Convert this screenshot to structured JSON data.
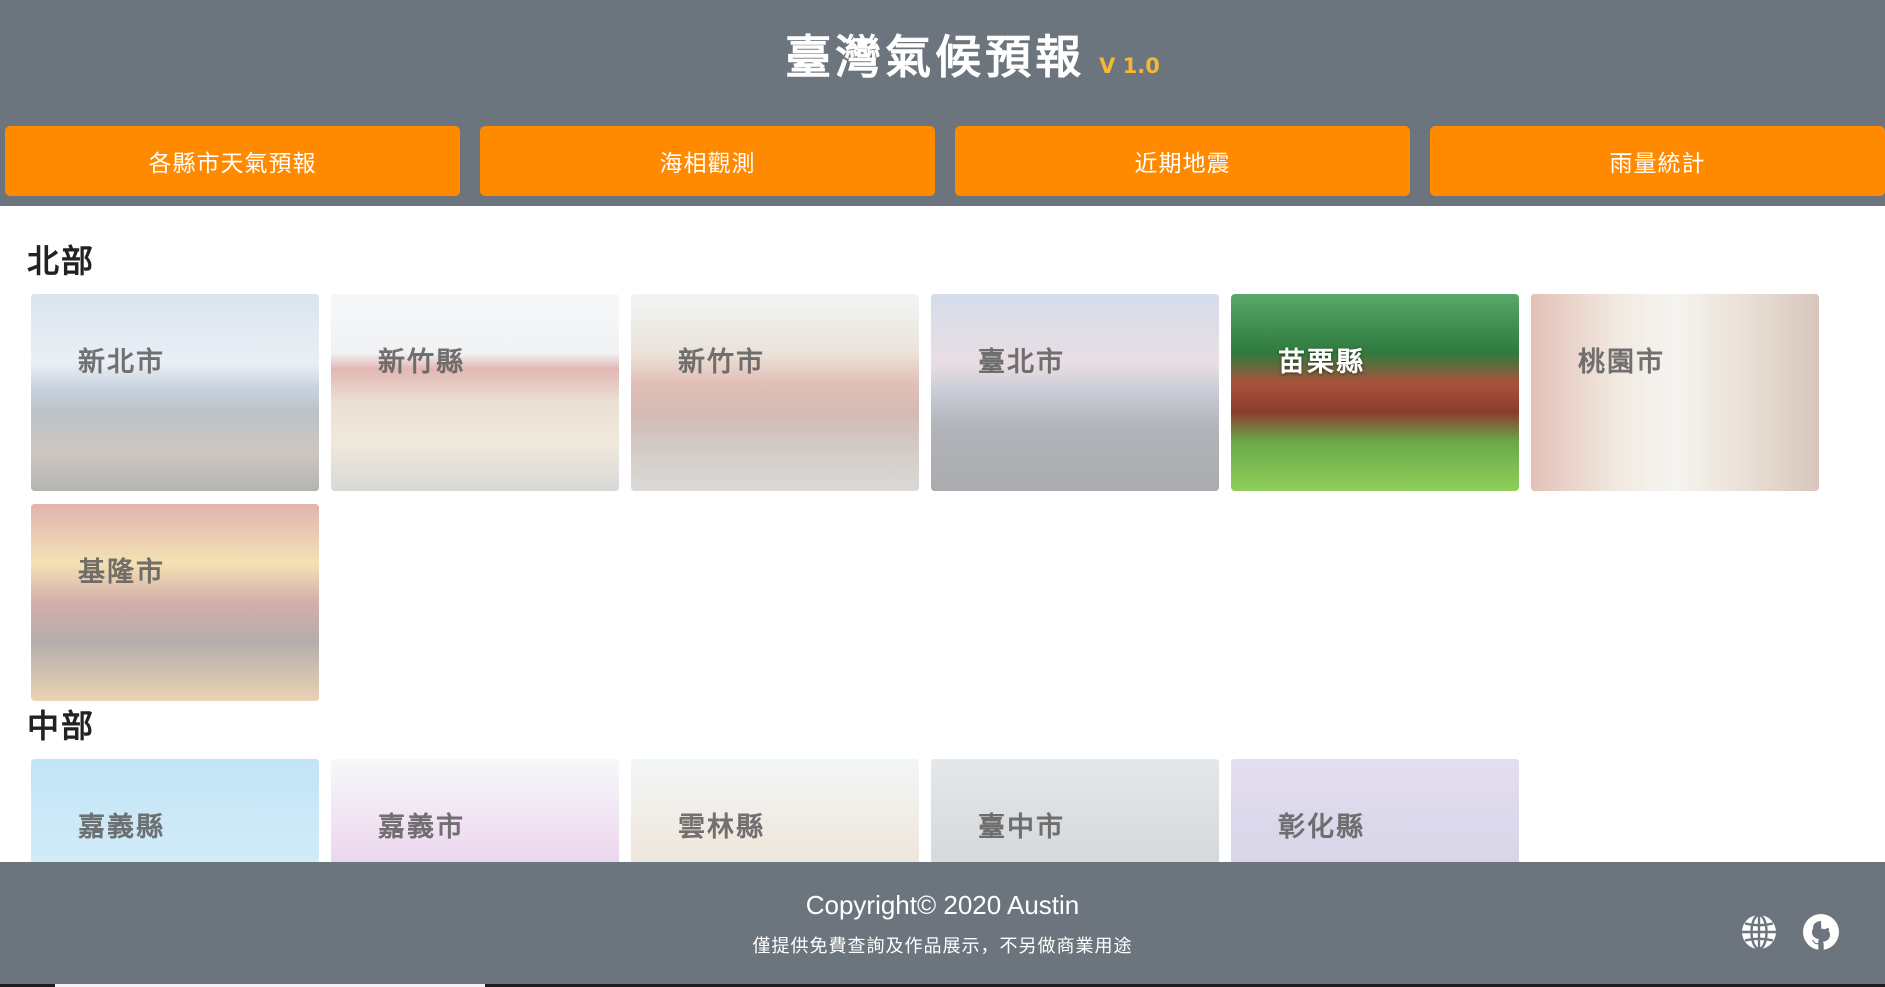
{
  "header": {
    "title": "臺灣氣候預報",
    "version": "V 1.0"
  },
  "nav": {
    "items": [
      "各縣市天氣預報",
      "海相觀測",
      "近期地震",
      "雨量統計"
    ]
  },
  "regions": [
    {
      "title": "北部",
      "cities": [
        "新北市",
        "新竹縣",
        "新竹市",
        "臺北市",
        "苗栗縣",
        "桃園市",
        "基隆市"
      ]
    },
    {
      "title": "中部",
      "cities": [
        "嘉義縣",
        "嘉義市",
        "雲林縣",
        "臺中市",
        "彰化縣"
      ]
    }
  ],
  "active_city": "苗栗縣",
  "footer": {
    "copyright": "Copyright© 2020 Austin",
    "notice": "僅提供免費查詢及作品展示，不另做商業用途",
    "icons": [
      "globe-icon",
      "github-icon"
    ]
  },
  "colors": {
    "header_bg": "#6c757d",
    "nav_button": "#ff8a00",
    "version_text": "#f7b733"
  }
}
